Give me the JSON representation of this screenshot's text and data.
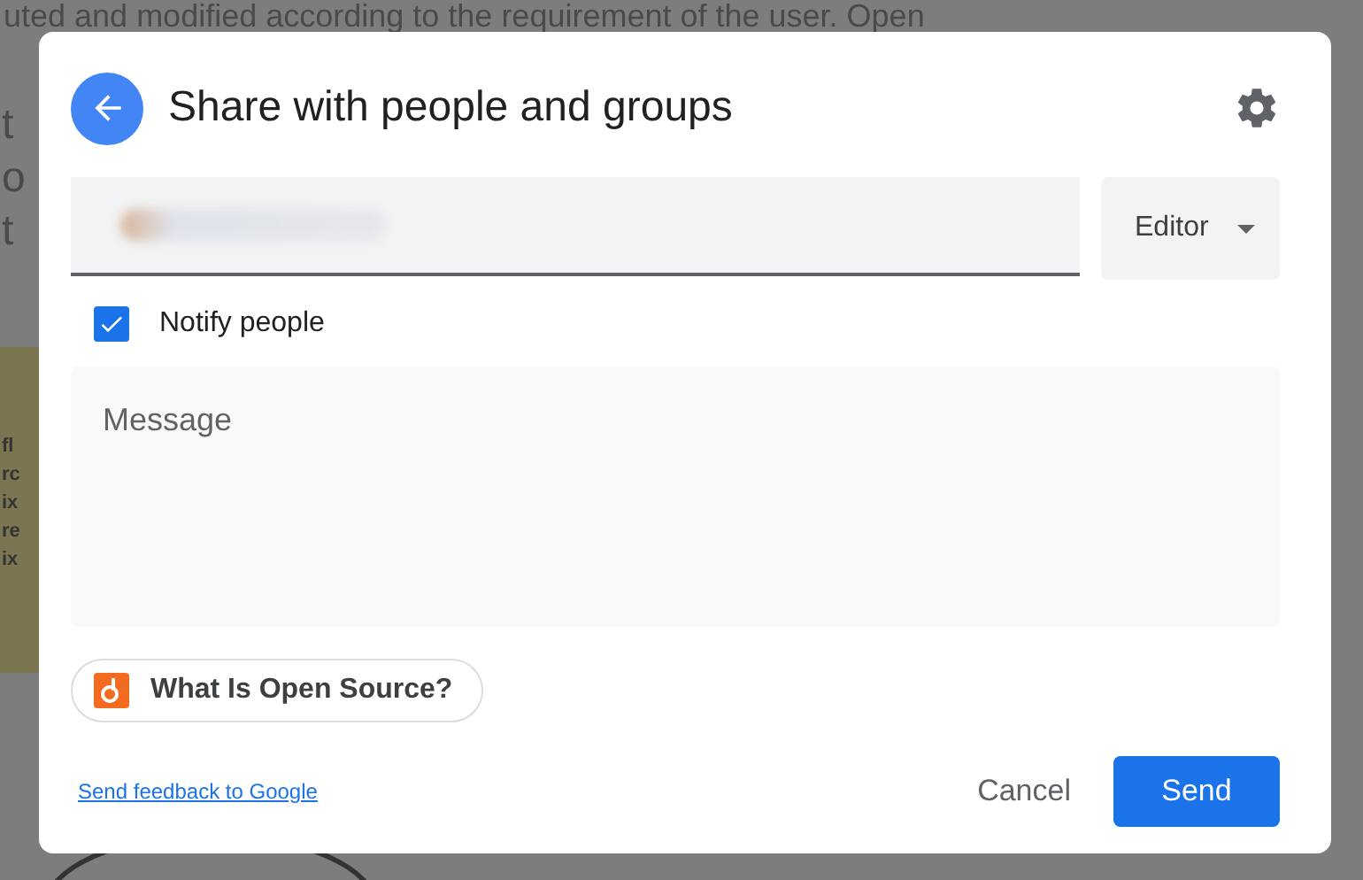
{
  "background": {
    "top_line": "uted and modified according to the requirement of the user. Open",
    "left_fragments": [
      "t",
      "o",
      "t"
    ],
    "box_fragments": [
      "fl",
      "rc",
      "ix",
      "re",
      "ix"
    ]
  },
  "dialog": {
    "title": "Share with people and groups",
    "recipients": {
      "chip_blurred": true
    },
    "role": {
      "value": "Editor"
    },
    "notify": {
      "label": "Notify people",
      "checked": true
    },
    "message": {
      "placeholder": "Message"
    },
    "attachment": {
      "label": "What Is Open Source?"
    },
    "feedback_link": "Send feedback to Google",
    "buttons": [
      {
        "label": "Cancel",
        "kind": "text"
      },
      {
        "label": "Send",
        "kind": "primary"
      }
    ]
  }
}
